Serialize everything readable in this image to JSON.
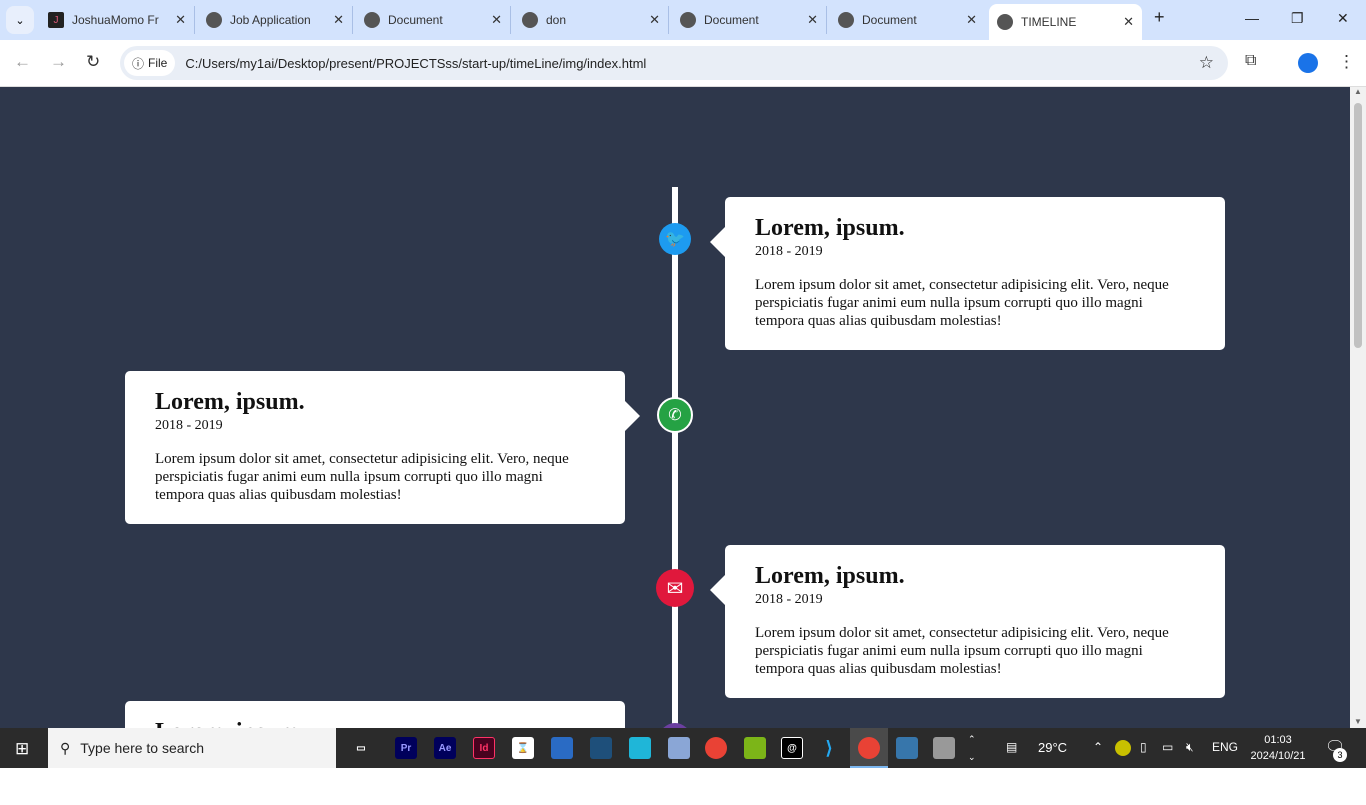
{
  "browser": {
    "tabs": [
      {
        "label": "JoshuaMomo Fr",
        "favicon": "J"
      },
      {
        "label": "Job Application",
        "favicon": "globe"
      },
      {
        "label": "Document",
        "favicon": "globe"
      },
      {
        "label": "don",
        "favicon": "globe"
      },
      {
        "label": "Document",
        "favicon": "globe"
      },
      {
        "label": "Document",
        "favicon": "globe"
      },
      {
        "label": "TIMELINE",
        "favicon": "globe",
        "active": true
      }
    ],
    "chip": "File",
    "url": "C:/Users/my1ai/Desktop/present/PROJECTSss/start-up/timeLine/img/index.html"
  },
  "timeline": [
    {
      "title": "Lorem, ipsum.",
      "date": "2018 - 2019",
      "text": "Lorem ipsum dolor sit amet, consectetur adipisicing elit. Vero, neque perspiciatis fugar animi eum nulla ipsum corrupti quo illo magni tempora quas alias quibusdam molestias!",
      "icon": "twitter-icon",
      "color": "#1d9bf0"
    },
    {
      "title": "Lorem, ipsum.",
      "date": "2018 - 2019",
      "text": "Lorem ipsum dolor sit amet, consectetur adipisicing elit. Vero, neque perspiciatis fugar animi eum nulla ipsum corrupti quo illo magni tempora quas alias quibusdam molestias!",
      "icon": "whatsapp-icon",
      "color": "#25a244"
    },
    {
      "title": "Lorem, ipsum.",
      "date": "2018 - 2019",
      "text": "Lorem ipsum dolor sit amet, consectetur adipisicing elit. Vero, neque perspiciatis fugar animi eum nulla ipsum corrupti quo illo magni tempora quas alias quibusdam molestias!",
      "icon": "mail-icon",
      "color": "#e0183c"
    },
    {
      "title": "Lorem, ipsum.",
      "icon": "instagram-icon",
      "color": "#6b3fa0"
    }
  ],
  "taskbar": {
    "search_placeholder": "Type here to search",
    "apps": [
      "Pr",
      "Ae",
      "Id"
    ],
    "weather": "29°C",
    "lang": "ENG",
    "time": "01:03",
    "date": "2024/10/21",
    "notifications": "3"
  }
}
